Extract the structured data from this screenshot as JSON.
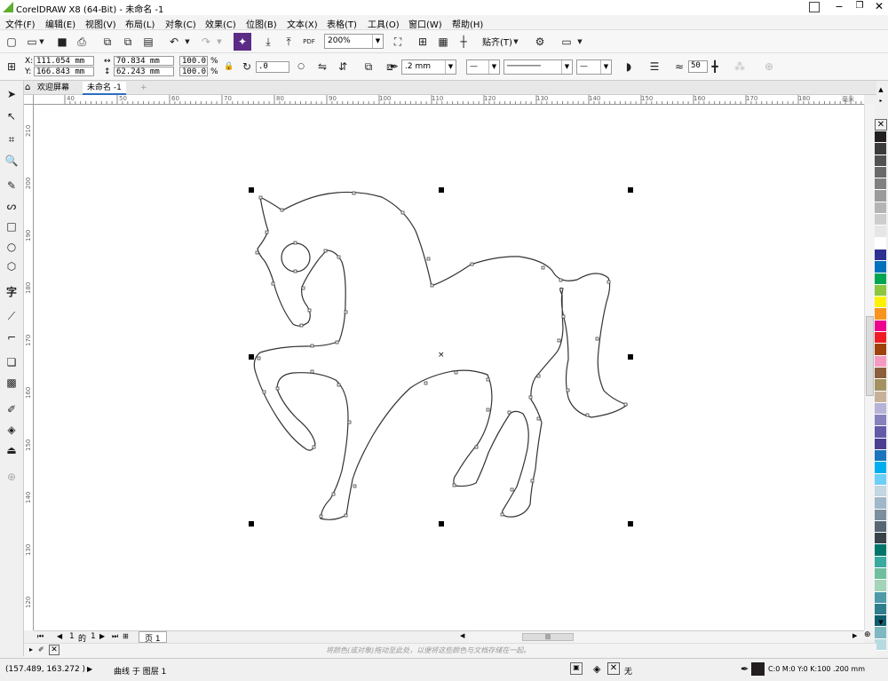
{
  "window": {
    "title": "CorelDRAW X8 (64-Bit) - 未命名 -1"
  },
  "menu": [
    "文件(F)",
    "编辑(E)",
    "视图(V)",
    "布局(L)",
    "对象(C)",
    "效果(C)",
    "位图(B)",
    "文本(X)",
    "表格(T)",
    "工具(O)",
    "窗口(W)",
    "帮助(H)"
  ],
  "toolbar": {
    "zoom": "200%",
    "snap_label": "贴齐(T)",
    "pdf_label": "PDF"
  },
  "props": {
    "x_label": "X:",
    "x": "111.054 mm",
    "y_label": "Y:",
    "y": "166.843 mm",
    "w": "70.834 mm",
    "h": "62.243 mm",
    "sx": "100.0",
    "sy": "100.0",
    "pct": "%",
    "angle": ".0",
    "outline": ".2 mm",
    "smooth": "50"
  },
  "tabs": {
    "welcome": "欢迎屏幕",
    "doc": "未命名 -1"
  },
  "rulers": {
    "h_ticks": [
      "40",
      "50",
      "60",
      "70",
      "80",
      "90",
      "100",
      "110",
      "120",
      "130",
      "140",
      "150",
      "160",
      "170",
      "180",
      "毫米"
    ],
    "v_ticks": [
      "210",
      "200",
      "190",
      "180",
      "170",
      "160",
      "150",
      "140",
      "130",
      "120"
    ]
  },
  "pagenav": {
    "current": "1",
    "of": "的",
    "total": "1",
    "page_tab": "页 1"
  },
  "docpalette": {
    "hint": "将颜色(或对象)拖动至此处，以便将这些颜色与文档存储在一起。"
  },
  "status": {
    "coords": "(157.489, 163.272 )",
    "object": "曲线 于 图层 1",
    "fill_label": "无",
    "outline_info": "C:0 M:0 Y:0 K:100 .200 mm"
  },
  "colors": {
    "accent": "#2a6ebf",
    "palette": [
      "#231f20",
      "#3b3b3b",
      "#525252",
      "#696969",
      "#808080",
      "#9b9b9b",
      "#b4b4b4",
      "#cdcdcd",
      "#e6e6e6",
      "#ffffff",
      "#2e3192",
      "#0072bc",
      "#00a651",
      "#8dc63f",
      "#fff200",
      "#f7941d",
      "#ec008c",
      "#ed1c24",
      "#a0410d",
      "#f49ac1",
      "#8b5e3c",
      "#a39161",
      "#c7b299",
      "#b6b3d6",
      "#8781bd",
      "#605ca8",
      "#4a3f91",
      "#1b75bc",
      "#00aeef",
      "#6dcff6",
      "#c2d6e4",
      "#9fb7c8",
      "#7b8f9e",
      "#566673",
      "#384249",
      "#00746b",
      "#3aa99f",
      "#6fbf9e",
      "#a3d4b8",
      "#4f9aa8",
      "#2f7e8d",
      "#0e5f6e",
      "#7fb8c0",
      "#b6dbe1"
    ]
  }
}
